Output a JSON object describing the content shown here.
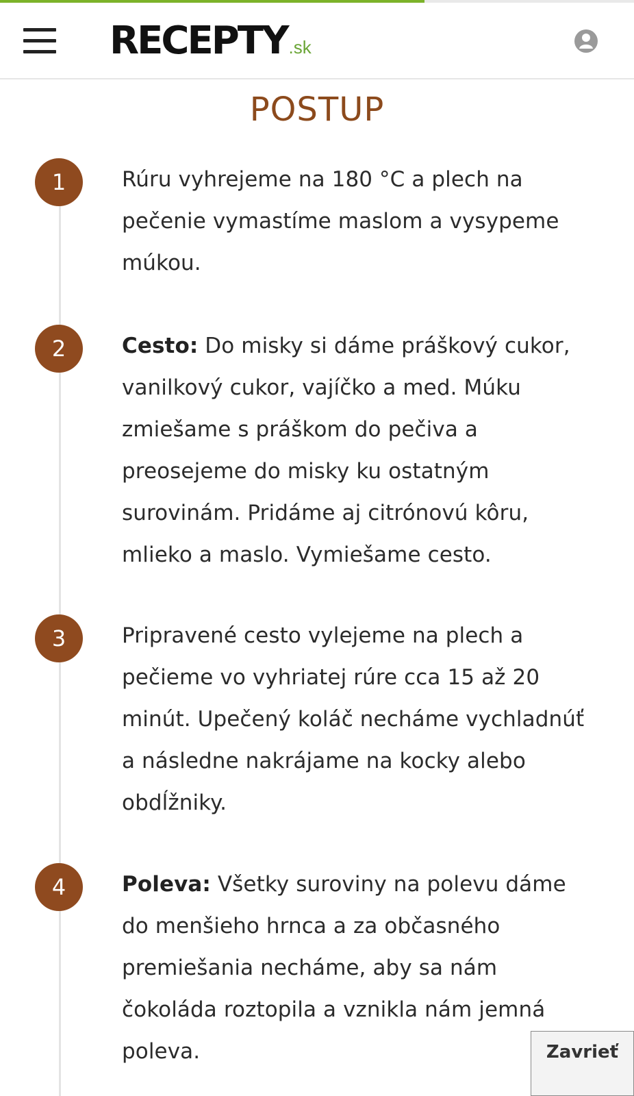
{
  "header": {
    "logo_main": "RECEPTY",
    "logo_tld": ".sk",
    "menu_icon": "hamburger-menu-icon",
    "user_icon": "user-account-icon",
    "progress_fraction": 0.67
  },
  "section": {
    "title": "POSTUP"
  },
  "steps": [
    {
      "number": "1",
      "label": "",
      "text": "Rúru vyhrejeme na 180 °C a plech na pečenie vymastíme maslom a vysypeme múkou."
    },
    {
      "number": "2",
      "label": "Cesto:",
      "text": " Do misky si dáme práškový cukor, vanilkový cukor, vajíčko a med. Múku zmiešame s práškom do pečiva a preosejeme do misky ku ostatným surovinám. Pridáme aj citrónovú kôru, mlieko a maslo. Vymiešame cesto."
    },
    {
      "number": "3",
      "label": "",
      "text": "Pripravené cesto vylejeme na plech a pečieme vo vyhriatej rúre cca 15 až 20 minút. Upečený koláč necháme vychladnúť a následne nakrájame na kocky alebo obdĺžniky."
    },
    {
      "number": "4",
      "label": "Poleva:",
      "text": " Všetky suroviny na polevu dáme do menšieho hrnca a za občasného premiešania necháme, aby sa nám čokoláda roztopila a vznikla nám jemná poleva."
    }
  ],
  "close_button": {
    "label": "Zavrieť"
  },
  "colors": {
    "accent_brown": "#8f4a1f",
    "title_brown": "#8c4a1c",
    "progress_green": "#7cb32a",
    "logo_green": "#6aa536"
  }
}
